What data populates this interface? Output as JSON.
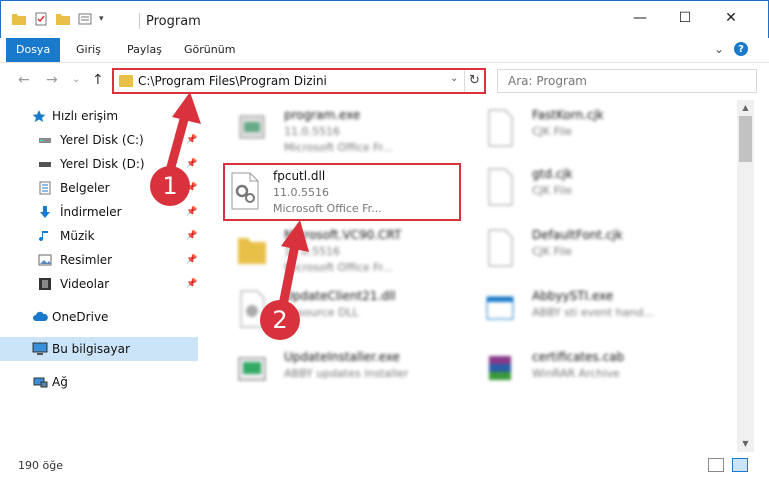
{
  "window": {
    "title": "Program",
    "minimize": "—",
    "maximize": "☐",
    "close": "✕"
  },
  "ribbon": {
    "tabs": [
      "Dosya",
      "Giriş",
      "Paylaş",
      "Görünüm"
    ],
    "expand_icon": "⌄",
    "help": "?"
  },
  "address": {
    "path": "C:\\Program Files\\Program Dizini",
    "back": "←",
    "forward": "→",
    "recent": "⌄",
    "up": "↑",
    "dropdown": "⌄",
    "refresh": "↻"
  },
  "search": {
    "placeholder": "Ara: Program"
  },
  "sidebar": {
    "items": [
      {
        "label": "Hızlı erişim",
        "icon": "star-icon",
        "pinned": false
      },
      {
        "label": "Yerel Disk (C:)",
        "icon": "drive-icon",
        "pinned": true
      },
      {
        "label": "Yerel Disk (D:)",
        "icon": "drive-icon",
        "pinned": true
      },
      {
        "label": "Belgeler",
        "icon": "documents-icon",
        "pinned": true
      },
      {
        "label": "İndirmeler",
        "icon": "download-icon",
        "pinned": true
      },
      {
        "label": "Müzik",
        "icon": "music-icon",
        "pinned": true
      },
      {
        "label": "Resimler",
        "icon": "pictures-icon",
        "pinned": true
      },
      {
        "label": "Videolar",
        "icon": "video-icon",
        "pinned": true
      },
      {
        "label": "OneDrive",
        "icon": "cloud-icon",
        "pinned": false
      },
      {
        "label": "Bu bilgisayar",
        "icon": "computer-icon",
        "pinned": false,
        "selected": true
      },
      {
        "label": "Ağ",
        "icon": "network-icon",
        "pinned": false
      }
    ],
    "pin_glyph": "📌"
  },
  "files": [
    {
      "name": "program.exe",
      "version": "11.0.5516",
      "desc": "Microsoft Office Fr...",
      "icon": "exe-icon"
    },
    {
      "name": "FastKorn.cjk",
      "version": "CJK File",
      "desc": "",
      "icon": "blank-file-icon"
    },
    {
      "name": "fpcutl.dll",
      "version": "11.0.5516",
      "desc": "Microsoft Office Fr...",
      "icon": "dll-gear-icon",
      "highlighted": true
    },
    {
      "name": "gtd.cjk",
      "version": "CJK File",
      "desc": "",
      "icon": "blank-file-icon"
    },
    {
      "name": "Microsoft.VC90.CRT",
      "version": "11.0.5516",
      "desc": "Microsoft Office Fr...",
      "icon": "folder-icon"
    },
    {
      "name": "DefaultFont.cjk",
      "version": "CJK File",
      "desc": "",
      "icon": "blank-file-icon"
    },
    {
      "name": "UpdateClient21.dll",
      "version": "Resource DLL",
      "desc": "",
      "icon": "dll-icon"
    },
    {
      "name": "AbbyySTI.exe",
      "version": "ABBY sti event hand...",
      "desc": "",
      "icon": "app-icon"
    },
    {
      "name": "UpdateInstaller.exe",
      "version": "ABBY updates installer",
      "desc": "",
      "icon": "installer-icon"
    },
    {
      "name": "certificates.cab",
      "version": "WinRAR Archive",
      "desc": "",
      "icon": "winrar-icon"
    }
  ],
  "status": {
    "count": "190 öğe"
  },
  "annotations": {
    "step1": "1",
    "step2": "2"
  },
  "colors": {
    "accent": "#1979ca",
    "highlight_red": "#d9323c",
    "selected_bg": "#cce4f7"
  }
}
